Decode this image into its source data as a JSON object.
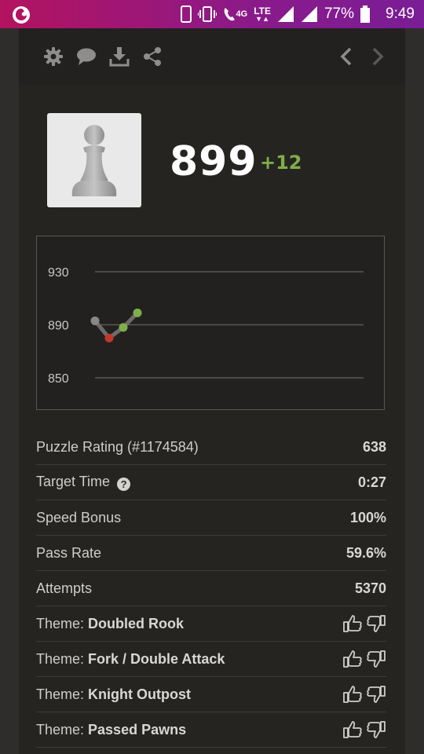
{
  "status_bar": {
    "network": "4G",
    "lte": "LTE",
    "battery": "77%",
    "time": "9:49"
  },
  "toolbar": {
    "icons": [
      "gear-icon",
      "chat-icon",
      "download-icon",
      "share-icon",
      "chevron-left-icon",
      "chevron-right-icon"
    ]
  },
  "profile": {
    "rating": "899",
    "delta": "+12"
  },
  "chart_data": {
    "type": "line",
    "y_ticks": [
      "930",
      "890",
      "850"
    ],
    "ylim": [
      850,
      930
    ],
    "grid": true,
    "x": [
      1,
      2,
      3,
      4
    ],
    "values": [
      893,
      880,
      888,
      899
    ],
    "point_colors": [
      "#8a8886",
      "#c0392b",
      "#7fae4a",
      "#7fae4a"
    ]
  },
  "stats": [
    {
      "label": "Puzzle Rating (#1174584)",
      "value": "638"
    },
    {
      "label": "Target Time",
      "value": "0:27",
      "help": "?"
    },
    {
      "label": "Speed Bonus",
      "value": "100%"
    },
    {
      "label": "Pass Rate",
      "value": "59.6%"
    },
    {
      "label": "Attempts",
      "value": "5370"
    }
  ],
  "themes": [
    {
      "prefix": "Theme: ",
      "name": "Doubled Rook"
    },
    {
      "prefix": "Theme: ",
      "name": "Fork / Double Attack"
    },
    {
      "prefix": "Theme: ",
      "name": "Knight Outpost"
    },
    {
      "prefix": "Theme: ",
      "name": "Passed Pawns"
    }
  ],
  "colors": {
    "status_bar": "#9a1670",
    "panel": "#262421",
    "accent_green": "#7fae4a",
    "loss_red": "#c0392b"
  }
}
